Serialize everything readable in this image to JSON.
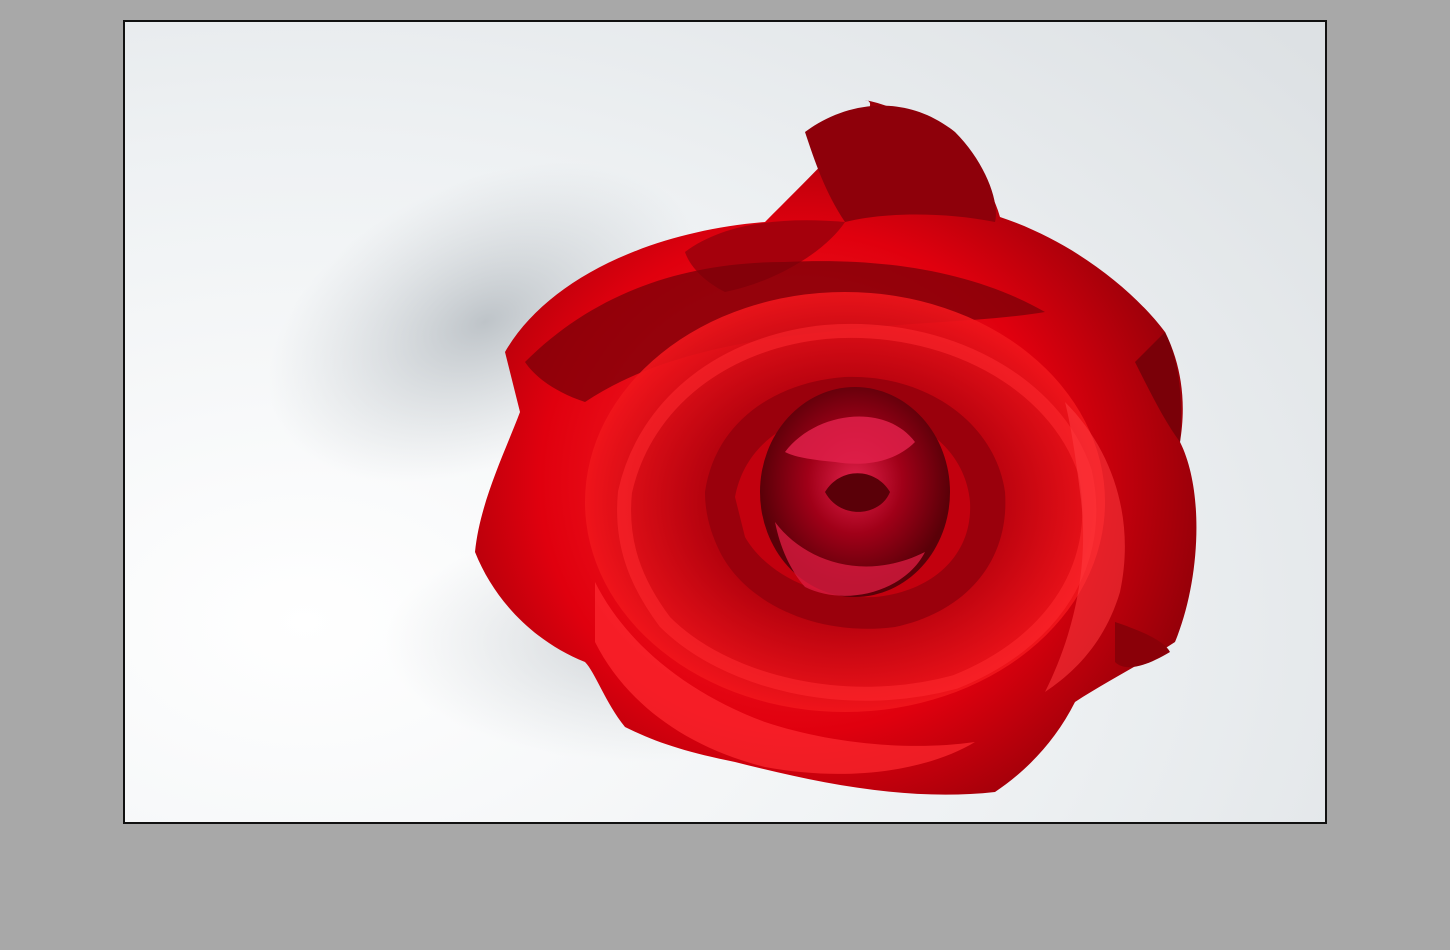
{
  "viewer": {
    "background_color": "#a8a8a8",
    "frame_border_color": "#111111"
  },
  "photo": {
    "subject_icon": "rose-image",
    "colors": {
      "backdrop": "#eef0f1",
      "shadow": "#c9ced2",
      "petal_deep": "#7a0008",
      "petal_mid": "#c8000c",
      "petal_bright": "#ff1a1f",
      "petal_highlight": "#ff3a4a",
      "center_pink": "#e0204a"
    }
  }
}
